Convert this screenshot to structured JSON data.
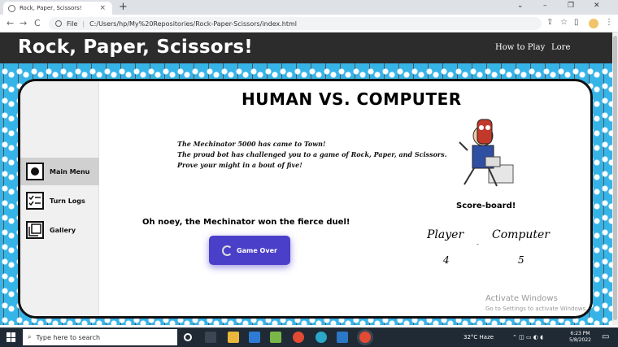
{
  "browser": {
    "tab_title": "Rock, Paper, Scissors!",
    "tab_close": "×",
    "new_tab": "+",
    "minimize": "⌄",
    "window_min": "–",
    "window_max": "❐",
    "window_close": "✕",
    "back": "←",
    "forward": "→",
    "reload": "C",
    "address_label": "File",
    "address_sep": "|",
    "url": "C:/Users/hp/My%20Repositories/Rock-Paper-Scissors/index.html",
    "share_icon": "share-icon",
    "star": "☆",
    "menu": "⋮"
  },
  "header": {
    "title": "Rock, Paper, Scissors!",
    "nav": [
      "How to Play",
      "Lore"
    ]
  },
  "sidebar": {
    "items": [
      {
        "label": "Main Menu",
        "icon": "record-icon",
        "active": true
      },
      {
        "label": "Turn Logs",
        "icon": "checklist-icon",
        "active": false
      },
      {
        "label": "Gallery",
        "icon": "gallery-icon",
        "active": false
      }
    ]
  },
  "main": {
    "heading": "HUMAN VS. COMPUTER",
    "intro": [
      "The Mechinator 5000 has came to Town!",
      "The proud bot has challenged you to a game of Rock, Paper, and Scissors.",
      "Prove your might in a bout of five!"
    ],
    "result": "Oh noey, the Mechinator won the fierce duel!",
    "button_label": "Game Over"
  },
  "scoreboard": {
    "title": "Score-board!",
    "player_label": "Player",
    "computer_label": "Computer",
    "separator": "-",
    "player_score": "4",
    "computer_score": "5"
  },
  "watermark": {
    "title": "Activate Windows",
    "subtitle": "Go to Settings to activate Windows."
  },
  "taskbar": {
    "search_placeholder": "Type here to search",
    "weather": "32°C  Haze",
    "time": "6:23 PM",
    "date": "5/8/2022"
  },
  "colors": {
    "header_bg": "#2c2c2c",
    "pattern_bg": "#36b4e8",
    "button": "#4a3fc9"
  }
}
